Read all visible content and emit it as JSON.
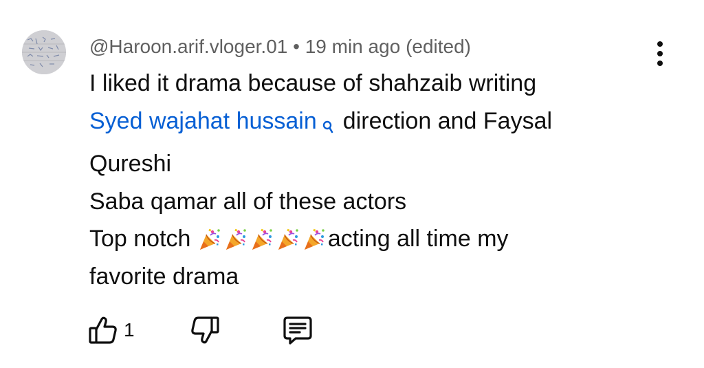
{
  "comment": {
    "author": "@Haroon.arif.vloger.01",
    "separator": " • ",
    "time": "19 min ago",
    "edited": "(edited)",
    "line1": "I liked it drama because of shahzaib writing",
    "mention_text": "Syed wajahat hussain",
    "mention_icon": "search-icon",
    "line2_rest": "direction and Faysal",
    "line3": "Qureshi",
    "line4": "Saba qamar all of these actors",
    "line5_prefix": "Top notch ",
    "line5_emoji": "party-popper-icon",
    "line5_emoji_count": 5,
    "line5_suffix": "acting all time my",
    "line6": "favorite drama"
  },
  "actions": {
    "like_icon": "thumbs-up-icon",
    "like_count": "1",
    "dislike_icon": "thumbs-down-icon",
    "reply_icon": "reply-icon",
    "more_icon": "more-vertical-icon"
  },
  "colors": {
    "text": "#0f0f0f",
    "meta": "#5f5f5f",
    "mention": "#065fd4"
  }
}
